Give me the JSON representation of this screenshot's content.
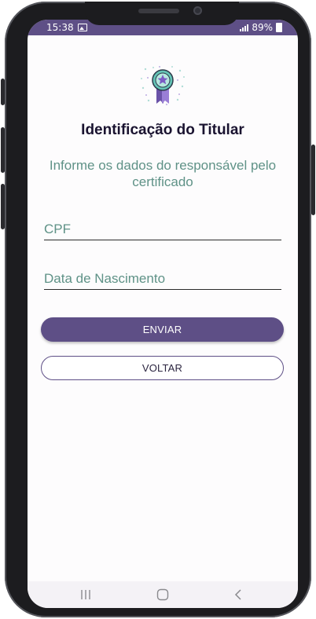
{
  "status_bar": {
    "time": "15:38",
    "battery": "89%",
    "icons": [
      "image-icon",
      "signal-icon",
      "battery-icon"
    ]
  },
  "form": {
    "title": "Identificação do Titular",
    "subtitle": "Informe os dados do responsável pelo certificado",
    "cpf_placeholder": "CPF",
    "birthdate_placeholder": "Data de Nascimento",
    "submit_label": "ENVIAR",
    "back_label": "VOLTAR"
  },
  "nav_bar": {
    "icons": [
      "recent-apps-icon",
      "home-icon",
      "back-icon"
    ]
  },
  "colors": {
    "primary": "#5e4f86",
    "accent_text": "#5f9287",
    "title_text": "#1a1330",
    "background": "#fdfcfd"
  }
}
